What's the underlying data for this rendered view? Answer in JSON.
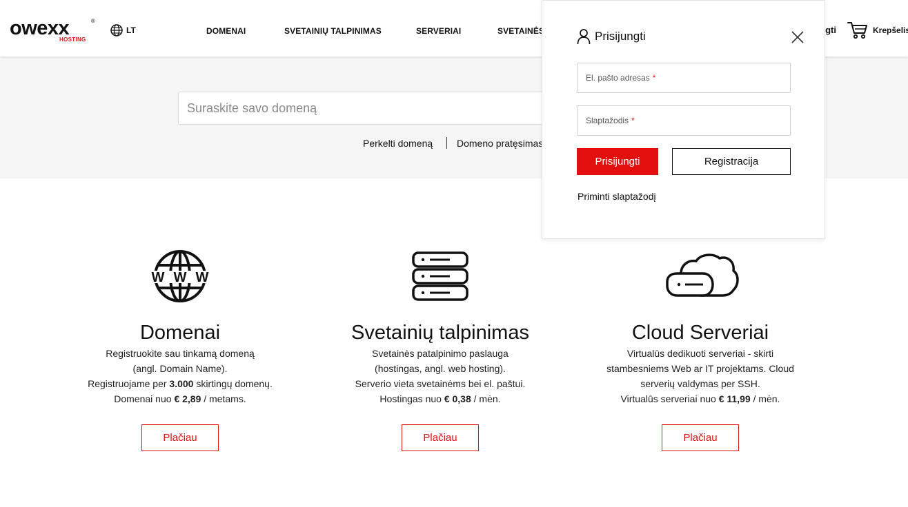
{
  "header": {
    "logo_main": "owexx",
    "logo_sub": "HOSTING",
    "logo_reg": "®",
    "lang": "LT",
    "nav": [
      "DOMENAI",
      "SVETAINIŲ TALPINIMAS",
      "SERVERIAI",
      "SVETAINĖS"
    ],
    "login_link": "Prisijungti",
    "cart_label": "Krepšelis"
  },
  "search": {
    "placeholder": "Suraskite savo domeną",
    "links": [
      "Perkelti domeną",
      "Domeno pratęsimas"
    ]
  },
  "features": [
    {
      "icon": "www-globe-icon",
      "title": "Domenai",
      "desc_lines": [
        "Registruokite sau tinkamą domeną",
        "(angl. Domain Name)."
      ],
      "line3_pre": "Registruojame per ",
      "line3_bold": "3.000",
      "line3_post": " skirtingų domenų.",
      "price_pre": "Domenai nuo ",
      "price": "€ 2,89",
      "price_post": " / metams.",
      "button": "Plačiau"
    },
    {
      "icon": "server-stack-icon",
      "title": "Svetainių talpinimas",
      "desc_lines": [
        "Svetainės patalpinimo paslauga",
        "(hostingas, angl. web hosting)."
      ],
      "line3_pre": "Serverio vieta svetainėms bei el. paštui.",
      "line3_bold": "",
      "line3_post": "",
      "price_pre": "Hostingas nuo ",
      "price": "€ 0,38",
      "price_post": " / mėn.",
      "button": "Plačiau"
    },
    {
      "icon": "cloud-server-icon",
      "title": "Cloud Serveriai",
      "desc_lines": [
        "Virtualūs dedikuoti serveriai - skirti",
        "stambesniems Web ar IT projektams. Cloud"
      ],
      "line3_pre": "serverių valdymas per SSH.",
      "line3_bold": "",
      "line3_post": "",
      "price_pre": "Virtualūs serveriai nuo ",
      "price": "€ 11,99",
      "price_post": " / mėn.",
      "button": "Plačiau"
    }
  ],
  "login_popup": {
    "title": "Prisijungti",
    "email_label": "El. pašto adresas",
    "password_label": "Slaptažodis",
    "required_mark": "*",
    "login_button": "Prisijungti",
    "register_button": "Registracija",
    "forgot_link": "Priminti slaptažodį"
  },
  "colors": {
    "accent": "#e31212",
    "band_bg": "#f5f5f5"
  }
}
